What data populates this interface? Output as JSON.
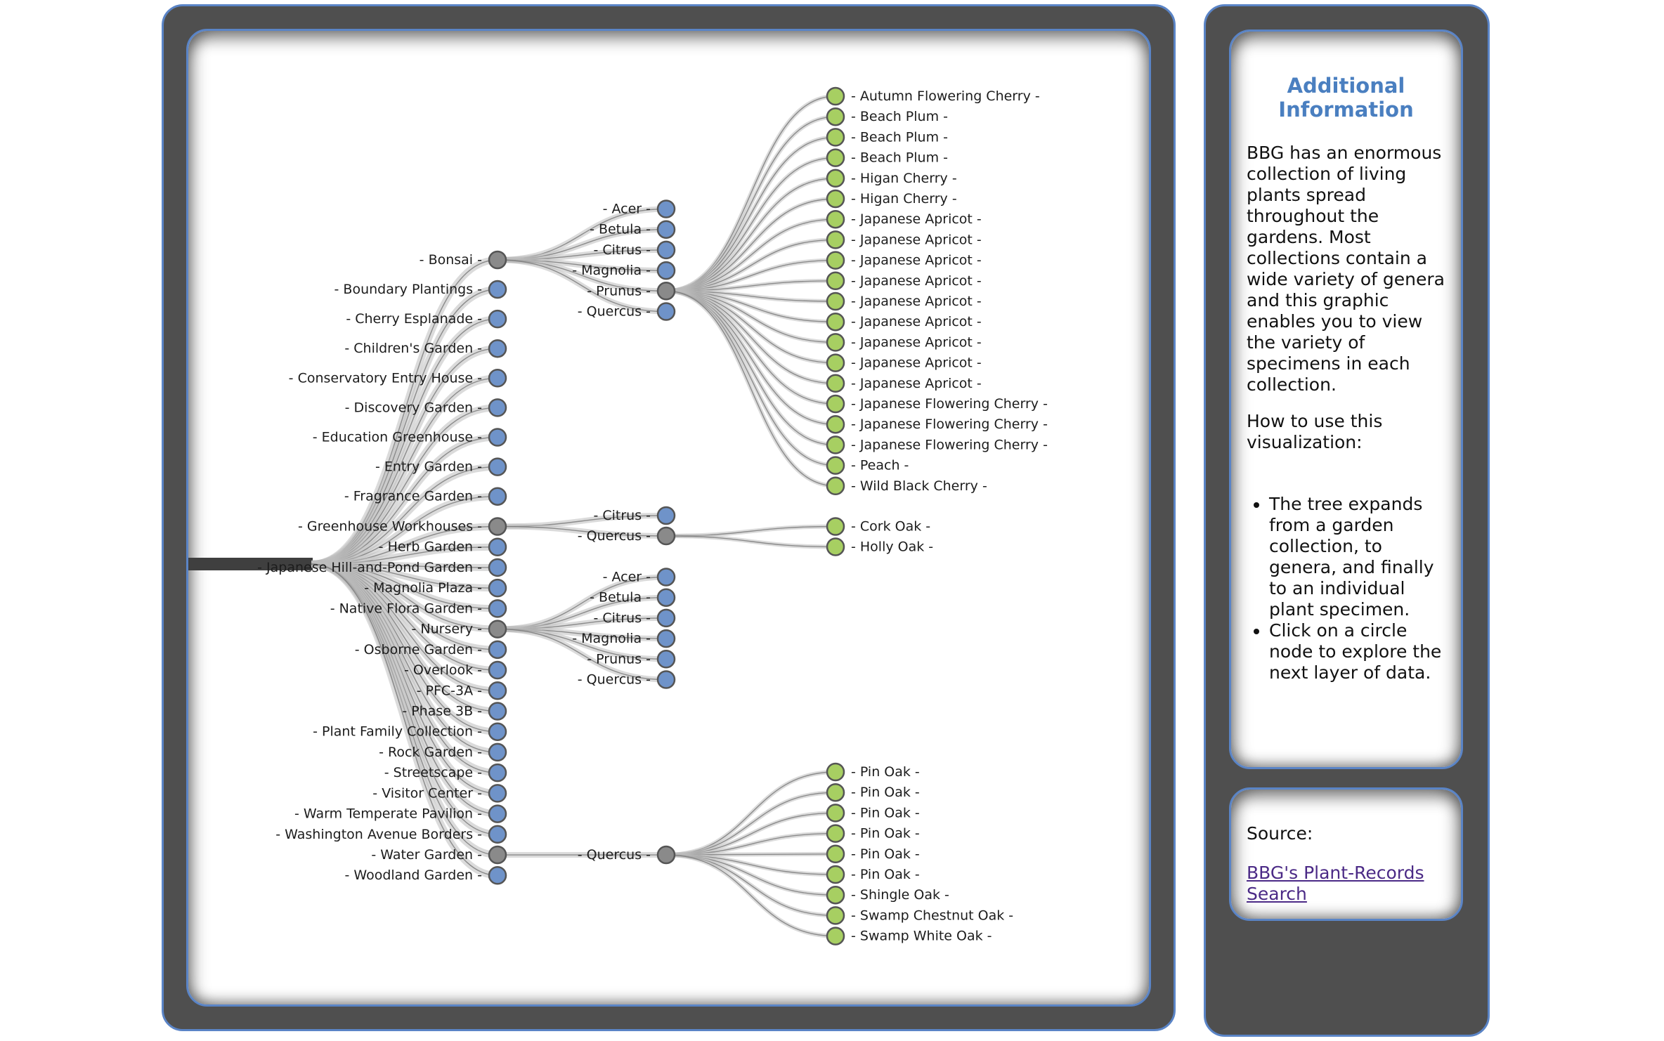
{
  "tree": {
    "collections": [
      "Bonsai",
      "Boundary Plantings",
      "Cherry Esplanade",
      "Children's Garden",
      "Conservatory Entry House",
      "Discovery Garden",
      "Education Greenhouse",
      "Entry Garden",
      "Fragrance Garden",
      "Greenhouse Workhouses",
      "Herb Garden",
      "Japanese Hill-and-Pond Garden",
      "Magnolia Plaza",
      "Native Flora Garden",
      "Nursery",
      "Osborne Garden",
      "Overlook",
      "PFC-3A",
      "Phase 3B",
      "Plant Family Collection",
      "Rock Garden",
      "Streetscape",
      "Visitor Center",
      "Warm Temperate Pavilion",
      "Washington Avenue Borders",
      "Water Garden",
      "Woodland Garden"
    ],
    "expanded_collections": [
      "Bonsai",
      "Greenhouse Workhouses",
      "Nursery",
      "Water Garden"
    ],
    "genera": [
      {
        "collection": "Bonsai",
        "items": [
          "Acer",
          "Betula",
          "Citrus",
          "Magnolia",
          "Prunus",
          "Quercus"
        ],
        "expanded": "Prunus"
      },
      {
        "collection": "Greenhouse Workhouses",
        "items": [
          "Citrus",
          "Quercus"
        ],
        "expanded": "Quercus"
      },
      {
        "collection": "Nursery",
        "items": [
          "Acer",
          "Betula",
          "Citrus",
          "Magnolia",
          "Prunus",
          "Quercus"
        ],
        "expanded": null
      },
      {
        "collection": "Water Garden",
        "items": [
          "Quercus"
        ],
        "expanded": "Quercus"
      }
    ],
    "specimens": [
      {
        "parent": "Bonsai / Prunus",
        "items": [
          "Autumn Flowering Cherry",
          "Beach Plum",
          "Beach Plum",
          "Beach Plum",
          "Higan Cherry",
          "Higan Cherry",
          "Japanese Apricot",
          "Japanese Apricot",
          "Japanese Apricot",
          "Japanese Apricot",
          "Japanese Apricot",
          "Japanese Apricot",
          "Japanese Apricot",
          "Japanese Apricot",
          "Japanese Apricot",
          "Japanese Flowering Cherry",
          "Japanese Flowering Cherry",
          "Japanese Flowering Cherry",
          "Peach",
          "Wild Black Cherry"
        ]
      },
      {
        "parent": "Greenhouse Workhouses / Quercus",
        "items": [
          "Cork Oak",
          "Holly Oak"
        ]
      },
      {
        "parent": "Water Garden / Quercus",
        "items": [
          "Pin Oak",
          "Pin Oak",
          "Pin Oak",
          "Pin Oak",
          "Pin Oak",
          "Pin Oak",
          "Shingle Oak",
          "Swamp Chestnut Oak",
          "Swamp White Oak"
        ]
      }
    ],
    "colors": {
      "expanded_node": "#8a8a8a",
      "collapsed_node": "#6f93c9",
      "leaf_node": "#a7cf62",
      "link": "#777777",
      "link_fill": "#bdbdbd",
      "root_bar": "#3f3f3f"
    }
  },
  "info": {
    "title": "Additional Information",
    "paragraph1": "BBG has an enormous collection of living plants spread throughout the gardens. Most collections contain a wide variety of genera and this graphic enables you to view the variety of specimens in each collection.",
    "paragraph2": "How to use this visualization:",
    "bullets": [
      "The tree expands from a garden collection, to genera, and finally to an individual plant specimen.",
      "Click on a circle node to explore the next layer of data."
    ]
  },
  "source": {
    "label": "Source:",
    "link_text": "BBG's Plant-Records Search"
  }
}
